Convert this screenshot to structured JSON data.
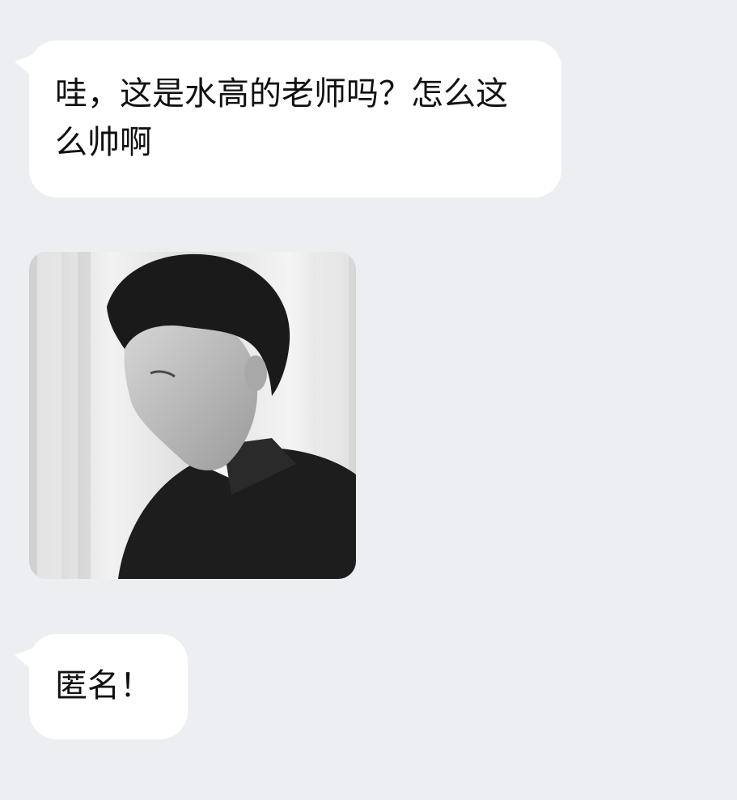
{
  "messages": [
    {
      "type": "text",
      "text": "哇，这是水高的老师吗？怎么这么帅啊"
    },
    {
      "type": "image",
      "image_icon": "portrait-photo-icon"
    },
    {
      "type": "text",
      "text": "匿名！"
    }
  ],
  "colors": {
    "background": "#eceef2",
    "bubble": "#ffffff",
    "text": "#111111"
  }
}
